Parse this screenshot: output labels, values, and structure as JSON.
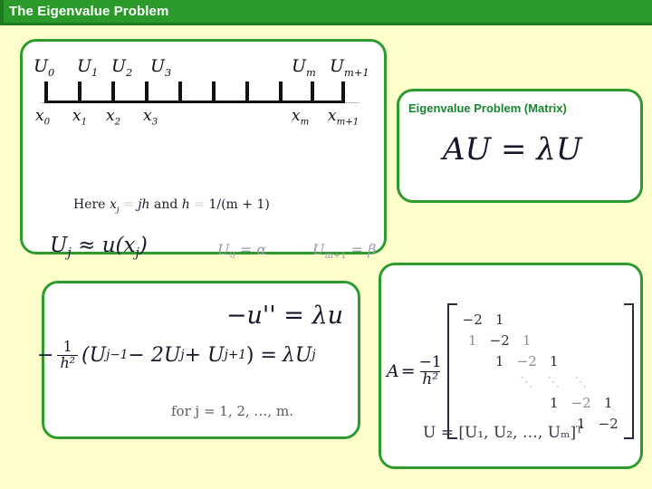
{
  "header": {
    "title": "The Eigenvalue Problem",
    "bar_color": "#2a9a2a",
    "text_color": "#ffffff"
  },
  "theme": {
    "background": "#ffffcc",
    "panel_border": "#2e9b2e",
    "panel_fill": "#ffffff",
    "accent_green": "#18852f"
  },
  "grid_panel": {
    "name": "discretization-grid",
    "u_labels": [
      {
        "base": "U",
        "sub": "0"
      },
      {
        "base": "U",
        "sub": "1"
      },
      {
        "base": "U",
        "sub": "2"
      },
      {
        "base": "U",
        "sub": "3"
      },
      {
        "base": "U",
        "sub": "m"
      },
      {
        "base": "U",
        "sub": "m+1"
      }
    ],
    "x_labels": [
      {
        "base": "x",
        "sub": "0"
      },
      {
        "base": "x",
        "sub": "1"
      },
      {
        "base": "x",
        "sub": "2"
      },
      {
        "base": "x",
        "sub": "3"
      },
      {
        "base": "x",
        "sub": "m"
      },
      {
        "base": "x",
        "sub": "m+1"
      }
    ],
    "tick_count": 10,
    "here_line": {
      "prefix": "Here",
      "x_sym": "x",
      "x_sub": "j",
      "eq1": "=",
      "jh": "jh",
      "and": "and",
      "h": "h",
      "eq2": "=",
      "value": "1/(m + 1)"
    },
    "approx_line": {
      "lhs_base": "U",
      "lhs_sub": "j",
      "rel": "≈",
      "rhs": "u(x",
      "rhs_sub": "j",
      "rhs_tail": ")"
    },
    "boundary_left": {
      "base": "U",
      "sub": "0",
      "eq": "=",
      "value": "α"
    },
    "boundary_right": {
      "base": "U",
      "sub": "m+1",
      "eq": "=",
      "value": "β"
    }
  },
  "matrix_eq_panel": {
    "heading": "Eigenvalue Problem (Matrix)",
    "formula": "AU = λU"
  },
  "diffeq_panel": {
    "ode": "−u'' = λu",
    "fd": {
      "minus": "−",
      "frac_num": "1",
      "frac_den": "h²",
      "body": "(U",
      "sub1": "j−1",
      "mid": " − 2U",
      "sub2": "j",
      "mid2": " + U",
      "sub3": "j+1",
      "close": ") =",
      "rhs": "λU",
      "rhs_sub": "j"
    },
    "range": "for j = 1, 2,  …, m."
  },
  "matrix_panel": {
    "symbol": "A",
    "equals": "=",
    "scalar_num": "−1",
    "scalar_den": "h²",
    "matrix_rows": [
      [
        "−2",
        "1",
        "",
        "",
        "",
        ""
      ],
      [
        "1",
        "−2",
        "1",
        "",
        "",
        ""
      ],
      [
        "",
        "1",
        "−2",
        "1",
        "",
        ""
      ],
      [
        "",
        "",
        "⋱",
        "⋱",
        "⋱",
        ""
      ],
      [
        "",
        "",
        "",
        "1",
        "−2",
        "1"
      ],
      [
        "",
        "",
        "",
        "",
        "1",
        "−2"
      ]
    ],
    "vector_line": "U = [U₁, U₂,  …, Uₘ]ᵀ"
  }
}
